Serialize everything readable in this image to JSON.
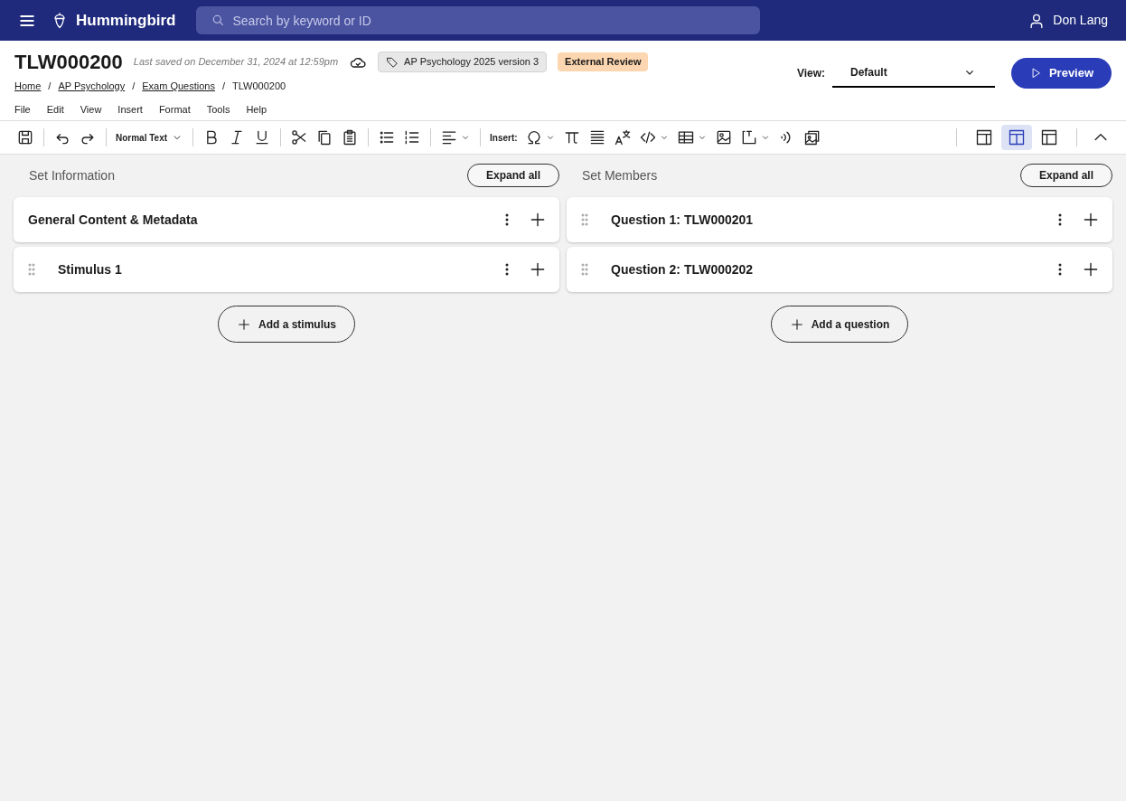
{
  "app": {
    "name": "Hummingbird",
    "search_placeholder": "Search by keyword or ID",
    "user": "Don Lang"
  },
  "document": {
    "id": "TLW000200",
    "last_saved": "Last saved on December 31, 2024 at 12:59pm",
    "tag": "AP Psychology 2025 version 3",
    "status": "External Review"
  },
  "breadcrumbs": [
    {
      "label": "Home",
      "link": true
    },
    {
      "separator": "/",
      "label": "AP Psychology",
      "link": true
    },
    {
      "separator": "/",
      "label": "Exam Questions",
      "link": true
    },
    {
      "separator": "/",
      "label": "TLW000200",
      "link": false
    }
  ],
  "view": {
    "label": "View:",
    "value": "Default"
  },
  "preview_button": "Preview",
  "menu": [
    "File",
    "Edit",
    "View",
    "Insert",
    "Format",
    "Tools",
    "Help"
  ],
  "toolbar": {
    "text_style": "Normal Text",
    "insert_label": "Insert:"
  },
  "layouts": [
    {
      "selected": false
    },
    {
      "selected": true
    },
    {
      "selected": false
    }
  ],
  "panels": [
    {
      "title": "Set Information",
      "expand_button": "Expand all",
      "items": [
        {
          "title": "General Content & Metadata",
          "drag_handle": false
        },
        {
          "title": "Stimulus 1",
          "drag_handle": true
        }
      ],
      "add_button": "Add a stimulus"
    },
    {
      "title": "Set Members",
      "expand_button": "Expand all",
      "items": [
        {
          "title": "Question 1: TLW000201",
          "drag_handle": true
        },
        {
          "title": "Question 2: TLW000202",
          "drag_handle": true
        }
      ],
      "add_button": "Add a question"
    }
  ]
}
